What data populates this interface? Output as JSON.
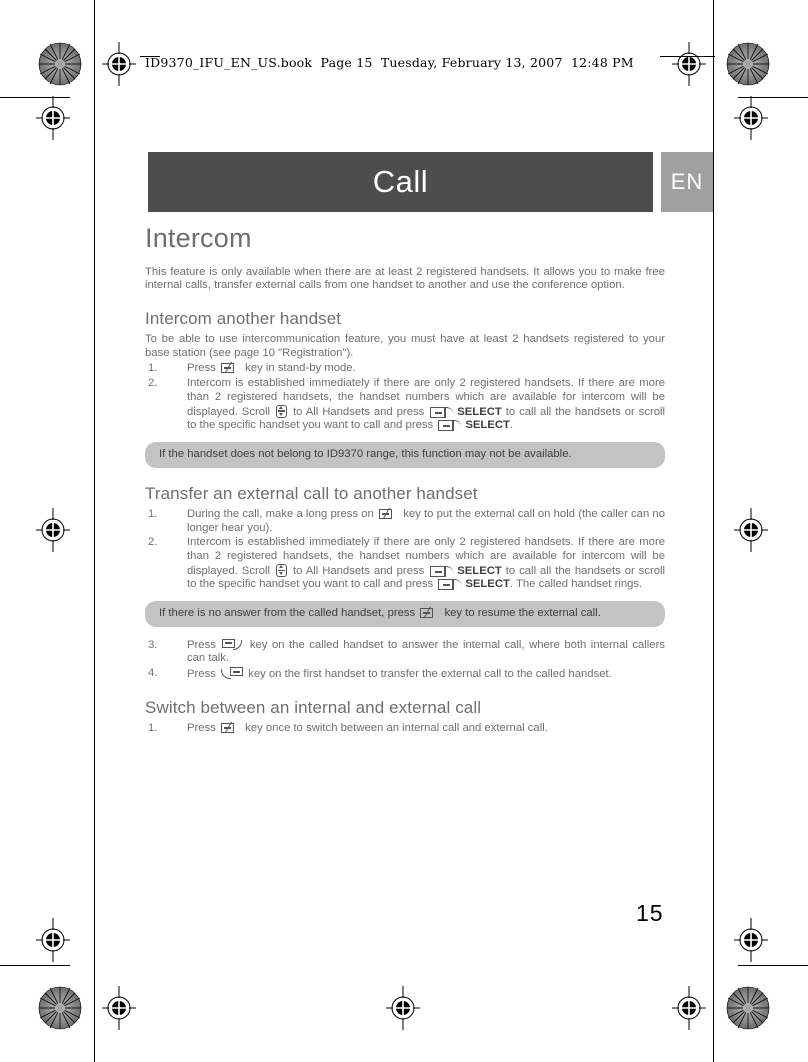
{
  "print_header": {
    "text": "ID9370_IFU_EN_US.book  Page 15  Tuesday, February 13, 2007  12:48 PM"
  },
  "chapter": {
    "title": "Call",
    "language_tab": "EN",
    "bar_color": "#4d4d4d",
    "tab_color": "#a0a0a0"
  },
  "page_number": "15",
  "section": {
    "heading": "Intercom",
    "intro": "This feature is only available when there are at least 2 registered handsets. It allows you to make free internal calls, transfer external calls from one handset to another and use the conference option."
  },
  "sub1": {
    "heading": "Intercom another handset",
    "intro": "To be able to use intercommunication feature, you must have at least 2 handsets registered to your base station (see page 10 \"Registration\").",
    "step1": {
      "num": "1.",
      "a": "Press",
      "icon": "talk-key-icon",
      "b": "key in stand-by mode."
    },
    "step2": {
      "num": "2.",
      "a": "Intercom is established immediately if there are only 2 registered handsets. If there are more than 2 registered handsets, the handset numbers which are available for intercom will be displayed. Scroll",
      "icon_scroll": "scroll-key-icon",
      "b": "to All Handsets and press",
      "icon_soft1": "softkey-icon",
      "softkey1": "SELECT",
      "c": "to call all the handsets or scroll to the specific handset you want to call and press",
      "icon_soft2": "softkey-icon",
      "softkey2": "SELECT",
      "d": "."
    },
    "note": "If the handset does not belong to ID9370 range, this function may not be available."
  },
  "sub2": {
    "heading": "Transfer an external call to another handset",
    "step1": {
      "num": "1.",
      "a": "During the call, make a long press on",
      "icon": "talk-key-icon",
      "b": "key to put the external call on hold (the caller can no longer hear you)."
    },
    "step2": {
      "num": "2.",
      "a": "Intercom is established immediately if there are only 2 registered handsets. If there are more than 2 registered handsets, the handset numbers which are available for intercom will be displayed. Scroll",
      "icon_scroll": "scroll-key-icon",
      "b": "to All Handsets and press",
      "icon_soft1": "softkey-icon",
      "softkey1": "SELECT",
      "c": "to call all the handsets or scroll to the specific handset you want to call and press",
      "icon_soft2": "softkey-icon",
      "softkey2": "SELECT",
      "d": ". The called handset rings."
    },
    "note": {
      "a": "If there is no answer from the called handset, press",
      "icon": "talk-key-icon",
      "b": "key to resume the external call."
    },
    "step3": {
      "num": "3.",
      "a": "Press",
      "icon": "answer-key-icon",
      "b": "key on the called handset to answer the internal call, where both internal callers can talk."
    },
    "step4": {
      "num": "4.",
      "a": "Press",
      "icon": "transfer-key-icon",
      "b": "key on the first handset to transfer the external call to the called handset."
    }
  },
  "sub3": {
    "heading": "Switch between an internal and external call",
    "step1": {
      "num": "1.",
      "a": "Press",
      "icon": "talk-key-icon",
      "b": "key once to switch between an internal call and external call."
    }
  }
}
